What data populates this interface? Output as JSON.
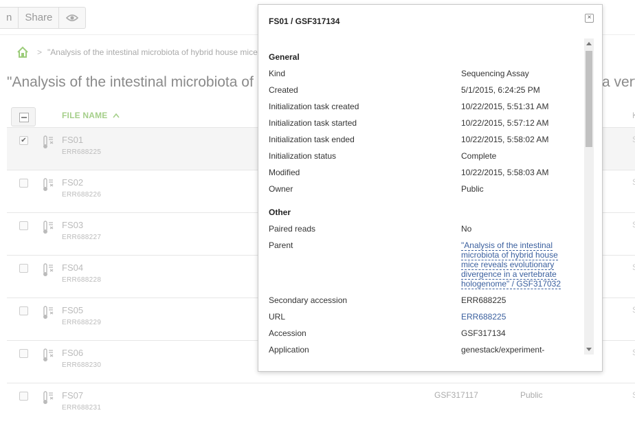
{
  "toolbar": {
    "open_partial": "n",
    "share": "Share",
    "view_icon": "eye-icon"
  },
  "breadcrumb": {
    "home_icon": "home-icon",
    "separator": ">",
    "current": "\"Analysis of the intestinal microbiota of hybrid house mice"
  },
  "page": {
    "title_partial": "\"Analysis of the intestinal microbiota of",
    "title_tail": "a vert"
  },
  "table": {
    "header": {
      "name": "FILE NAME",
      "sort_icon": "caret-up-icon",
      "col_k": "K"
    },
    "rows": [
      {
        "name": "FS01",
        "acc": "ERR688225",
        "checked": "✔",
        "gsf": "",
        "owner": "",
        "col_s": "S"
      },
      {
        "name": "FS02",
        "acc": "ERR688226",
        "checked": "",
        "gsf": "",
        "owner": "",
        "col_s": "S"
      },
      {
        "name": "FS03",
        "acc": "ERR688227",
        "checked": "",
        "gsf": "",
        "owner": "",
        "col_s": "S"
      },
      {
        "name": "FS04",
        "acc": "ERR688228",
        "checked": "",
        "gsf": "",
        "owner": "",
        "col_s": "S"
      },
      {
        "name": "FS05",
        "acc": "ERR688229",
        "checked": "",
        "gsf": "",
        "owner": "",
        "col_s": "S"
      },
      {
        "name": "FS06",
        "acc": "ERR688230",
        "checked": "",
        "gsf": "",
        "owner": "",
        "col_s": "S"
      },
      {
        "name": "FS07",
        "acc": "ERR688231",
        "checked": "",
        "gsf": "GSF317117",
        "owner": "Public",
        "col_s": "S"
      }
    ]
  },
  "popup": {
    "title": "FS01 / GSF317134",
    "close_icon": "close-icon",
    "general_heading": "General",
    "general": [
      {
        "label": "Kind",
        "value": "Sequencing Assay"
      },
      {
        "label": "Created",
        "value": "5/1/2015, 6:24:25 PM"
      },
      {
        "label": "Initialization task created",
        "value": "10/22/2015, 5:51:31 AM"
      },
      {
        "label": "Initialization task started",
        "value": "10/22/2015, 5:57:12 AM"
      },
      {
        "label": "Initialization task ended",
        "value": "10/22/2015, 5:58:02 AM"
      },
      {
        "label": "Initialization status",
        "value": "Complete"
      },
      {
        "label": "Modified",
        "value": "10/22/2015, 5:58:03 AM"
      },
      {
        "label": "Owner",
        "value": "Public"
      }
    ],
    "other_heading": "Other",
    "paired_reads": {
      "label": "Paired reads",
      "value": "No"
    },
    "parent": {
      "label": "Parent",
      "value": "\"Analysis of the intestinal microbiota of hybrid house mice reveals evolutionary divergence in a vertebrate hologenome\" / GSF317032"
    },
    "secondary_accession": {
      "label": "Secondary accession",
      "value": "ERR688225"
    },
    "url": {
      "label": "URL",
      "value": "ERR688225"
    },
    "accession": {
      "label": "Accession",
      "value": "GSF317134"
    },
    "application": {
      "label": "Application",
      "value": "genestack/experiment-"
    }
  }
}
